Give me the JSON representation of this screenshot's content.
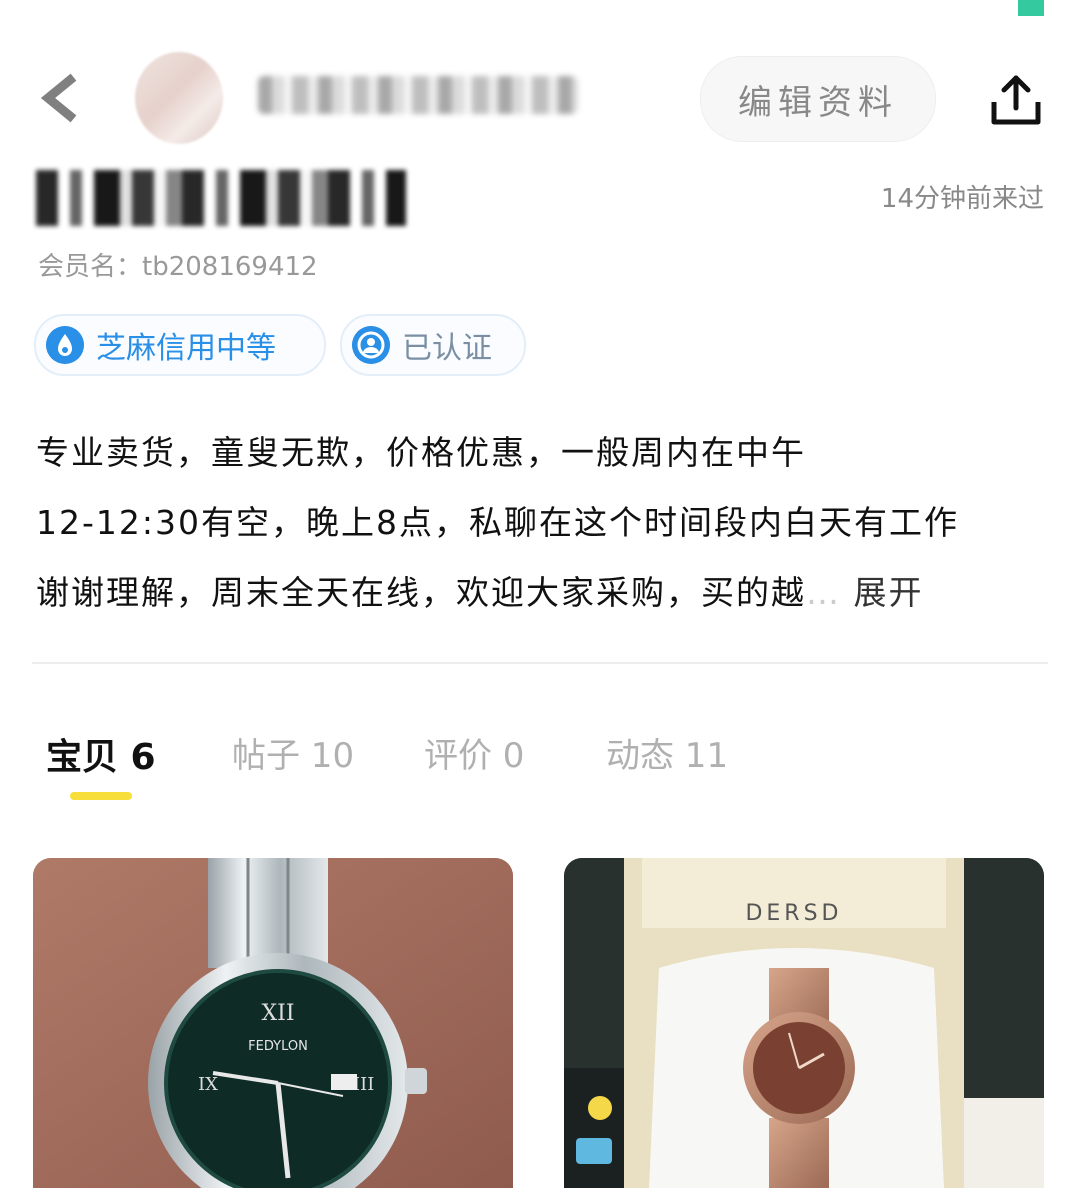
{
  "header": {
    "edit_label": "编辑资料",
    "back_icon": "back-arrow-icon",
    "share_icon": "share-icon"
  },
  "profile": {
    "last_seen": "14分钟前来过",
    "member_name": "会员名：tb208169412",
    "badges": [
      {
        "label": "芝麻信用中等",
        "icon": "sesame-credit-icon"
      },
      {
        "label": "已认证",
        "icon": "verified-user-icon"
      }
    ],
    "bio": {
      "line1": "专业卖货，童叟无欺，价格优惠，一般周内在中午",
      "line2": "12-12:30有空，晚上8点，私聊在这个时间段内白天有工作",
      "line3": "谢谢理解，周末全天在线，欢迎大家采购，买的越",
      "expand": "展开"
    }
  },
  "tabs": [
    {
      "label": "宝贝 6",
      "active": true
    },
    {
      "label": "帖子 10",
      "active": false
    },
    {
      "label": "评价 0",
      "active": false
    },
    {
      "label": "动态 11",
      "active": false
    }
  ],
  "products": [
    {
      "brand": "FEDYLON",
      "image": "silver-steel-watch-green-dial"
    },
    {
      "brand": "DERSD",
      "image": "rose-gold-mesh-watch-in-box"
    }
  ],
  "colors": {
    "accent_blue": "#2a8fe6",
    "tab_underline": "#f8de3a",
    "corner_mark": "#35c9a0"
  }
}
